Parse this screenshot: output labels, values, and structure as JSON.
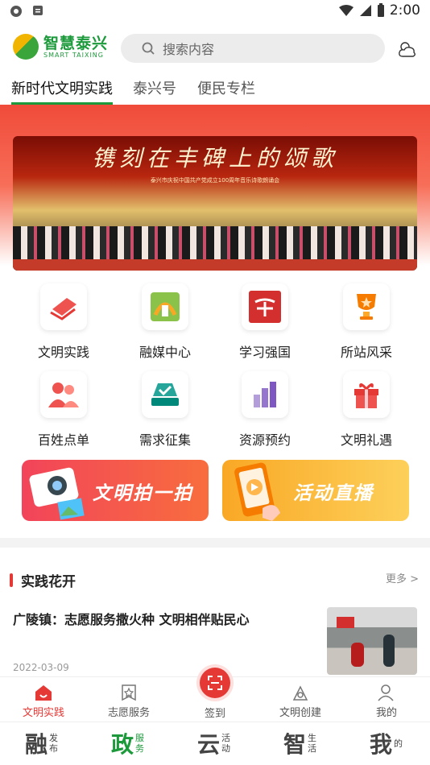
{
  "status_bar": {
    "time": "2:00"
  },
  "header": {
    "logo_text": "智慧泰兴",
    "logo_subtext": "SMART TAIXING",
    "search_placeholder": "搜索内容"
  },
  "tabs": [
    {
      "label": "新时代文明实践",
      "active": true
    },
    {
      "label": "泰兴号",
      "active": false
    },
    {
      "label": "便民专栏",
      "active": false
    }
  ],
  "banner": {
    "title": "镌刻在丰碑上的颂歌",
    "subtitle": "泰兴市庆祝中国共产党成立100周年音乐诗歌朗诵会"
  },
  "grid": [
    {
      "label": "文明实践",
      "icon": "book-icon"
    },
    {
      "label": "融媒中心",
      "icon": "media-icon"
    },
    {
      "label": "学习强国",
      "icon": "xuexi-icon"
    },
    {
      "label": "所站风采",
      "icon": "trophy-icon"
    },
    {
      "label": "百姓点单",
      "icon": "people-icon"
    },
    {
      "label": "需求征集",
      "icon": "ballot-icon"
    },
    {
      "label": "资源预约",
      "icon": "chart-icon"
    },
    {
      "label": "文明礼遇",
      "icon": "gift-icon"
    }
  ],
  "promos": [
    {
      "label": "文明拍一拍",
      "icon": "camera-icon"
    },
    {
      "label": "活动直播",
      "icon": "phone-icon"
    }
  ],
  "section": {
    "title": "实践花开",
    "more": "更多 >"
  },
  "news": {
    "title": "广陵镇：志愿服务撒火种 文明相伴贴民心",
    "date": "2022-03-09"
  },
  "bottom_nav": [
    {
      "label": "文明实践",
      "active": true
    },
    {
      "label": "志愿服务",
      "active": false
    },
    {
      "label": "签到",
      "active": false
    },
    {
      "label": "文明创建",
      "active": false
    },
    {
      "label": "我的",
      "active": false
    }
  ],
  "bottom_tabs": [
    {
      "big": "融",
      "small": "发布",
      "active": false
    },
    {
      "big": "政",
      "small": "服务",
      "active": true
    },
    {
      "big": "云",
      "small": "活动",
      "active": false
    },
    {
      "big": "智",
      "small": "生活",
      "active": false
    },
    {
      "big": "我",
      "small": "的",
      "active": false
    }
  ],
  "colors": {
    "brand_green": "#1c9a3b",
    "accent_red": "#e53935"
  }
}
